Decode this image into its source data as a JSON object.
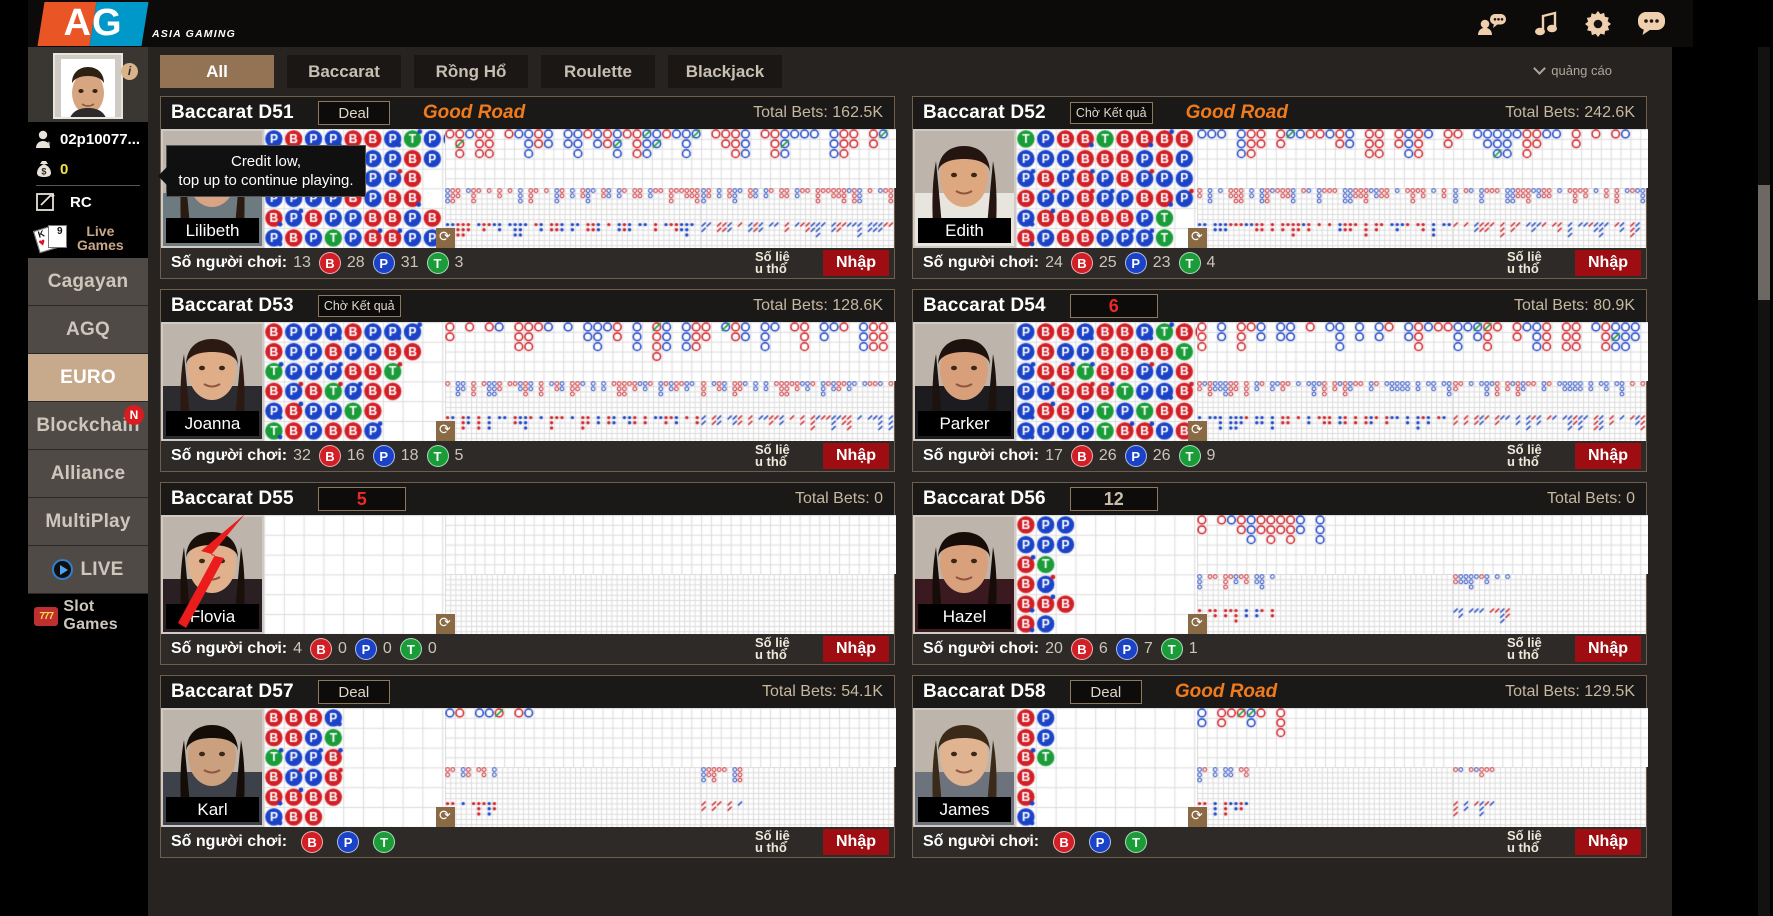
{
  "brand": {
    "logo_text": "AG",
    "tagline": "ASIA GAMING"
  },
  "topbar": {
    "icons": [
      {
        "name": "friends-chat-icon",
        "glyph": "friends"
      },
      {
        "name": "music-note-icon",
        "glyph": "music"
      },
      {
        "name": "gear-icon",
        "glyph": "gear"
      },
      {
        "name": "chat-bubble-icon",
        "glyph": "chat"
      }
    ]
  },
  "sidebar": {
    "account_name": "02p10077...",
    "balance": "0",
    "rc_label": "RC",
    "live_games_label": "Live\nGames",
    "live_games_line1": "Live",
    "live_games_line2": "Games",
    "info_badge": "i",
    "card_badge": "9",
    "items": [
      {
        "label": "Cagayan",
        "active": false,
        "badge": ""
      },
      {
        "label": "AGQ",
        "active": false,
        "badge": ""
      },
      {
        "label": "EURO",
        "active": true,
        "badge": ""
      },
      {
        "label": "Blockchain",
        "active": false,
        "badge": "N"
      },
      {
        "label": "Alliance",
        "active": false,
        "badge": ""
      },
      {
        "label": "MultiPlay",
        "active": false,
        "badge": ""
      },
      {
        "label": "LIVE",
        "active": false,
        "badge": ""
      },
      {
        "label": "Slot Games",
        "active": false,
        "badge": ""
      }
    ]
  },
  "tabs": [
    {
      "label": "All",
      "active": true
    },
    {
      "label": "Baccarat",
      "active": false
    },
    {
      "label": "Rồng Hổ",
      "active": false
    },
    {
      "label": "Roulette",
      "active": false
    },
    {
      "label": "Blackjack",
      "active": false
    }
  ],
  "advertisement_label": "quảng cáo",
  "tooltip": {
    "line1": "Credit low,",
    "line2": "top up to continue playing."
  },
  "footer_labels": {
    "players": "Số người chơi:",
    "stats_line1": "Số liệ",
    "stats_line2": "u thổ",
    "enter": "Nhập",
    "total_bets": "Total Bets:"
  },
  "colors": {
    "banker": "#d21f26",
    "player": "#1b43c8",
    "tie": "#1a9c38",
    "accent": "#937354",
    "good_road": "#f07b1d",
    "enter_button": "#9d0d12"
  },
  "tables": [
    {
      "name": "Baccarat D51",
      "state": "Deal",
      "state_type": "text",
      "good_road": "Good Road",
      "total_bets": "162.5K",
      "dealer": "Lilibeth",
      "dealer_hair": "#2a1a10",
      "dealer_skin": "#d8a484",
      "dealer_shirt": "#6d7a80",
      "players": "13",
      "b": "28",
      "p": "31",
      "t": "3",
      "bead": "PBPPBBPTPP|BBBPPPPBP|BBPPPPPB|PPPPBPBB|BPBPPBBPB|PBPTPBBPP",
      "empty": false
    },
    {
      "name": "Baccarat D52",
      "state": "Chờ Kết quả",
      "state_type": "wait",
      "good_road": "Good Road",
      "total_bets": "242.6K",
      "dealer": "Edith",
      "dealer_hair": "#241511",
      "dealer_skin": "#dda880",
      "dealer_shirt": "#e8e4de",
      "players": "24",
      "b": "25",
      "p": "23",
      "t": "4",
      "bead": "TPBBTBBBB|PPPBBBPBP|PBPBPBPPP|BPPBPPBBP|PBBBBBPT|BPBBPPPT",
      "empty": false
    },
    {
      "name": "Baccarat D53",
      "state": "Chờ Kết quả",
      "state_type": "wait",
      "good_road": "",
      "total_bets": "128.6K",
      "dealer": "Joanna",
      "dealer_hair": "#2c1a12",
      "dealer_skin": "#dfae88",
      "dealer_shirt": "#2b2b30",
      "players": "32",
      "b": "16",
      "p": "18",
      "t": "5",
      "bead": "BPPPBPPP|BPPBPPBB|TPPPBBT|BPBTPBB|PBPPTB|TBPBBP",
      "empty": false
    },
    {
      "name": "Baccarat D54",
      "state": "6",
      "state_type": "num-red",
      "good_road": "",
      "total_bets": "80.9K",
      "dealer": "Parker",
      "dealer_hair": "#1d120d",
      "dealer_skin": "#d8a07a",
      "dealer_shirt": "#1b1b20",
      "players": "17",
      "b": "26",
      "p": "26",
      "t": "9",
      "bead": "PBBPBBPTBB|PBPPBBBBT|PBBTBBPPB|PPBBBTPPB|PBBPTPTBB|PPPPTBBPB",
      "empty": false
    },
    {
      "name": "Baccarat D55",
      "state": "5",
      "state_type": "num-red",
      "good_road": "",
      "total_bets": "0",
      "dealer": "Flovia",
      "dealer_hair": "#1a1009",
      "dealer_skin": "#e0b18c",
      "dealer_shirt": "#2a1f22",
      "players": "4",
      "b": "0",
      "p": "0",
      "t": "0",
      "bead": "",
      "empty": true
    },
    {
      "name": "Baccarat D56",
      "state": "12",
      "state_type": "num-grey",
      "good_road": "",
      "total_bets": "0",
      "dealer": "Hazel",
      "dealer_hair": "#160d08",
      "dealer_skin": "#d9a07c",
      "dealer_shirt": "#3a1a20",
      "players": "20",
      "b": "6",
      "p": "7",
      "t": "1",
      "bead": "BPP|PPP|BT|BP|BBB|BP",
      "empty": false
    },
    {
      "name": "Baccarat D57",
      "state": "Deal",
      "state_type": "text",
      "good_road": "",
      "total_bets": "54.1K",
      "dealer": "Karl",
      "dealer_hair": "#140c07",
      "dealer_skin": "#caa07f",
      "dealer_shirt": "#3d4149",
      "players": "",
      "b": "",
      "p": "",
      "t": "",
      "bead": "BBBP|BBPT|TPPB|BPPB|BBBB|PBB",
      "empty": false
    },
    {
      "name": "Baccarat D58",
      "state": "Deal",
      "state_type": "text",
      "good_road": "Good Road",
      "total_bets": "129.5K",
      "dealer": "James",
      "dealer_hair": "#3b2a18",
      "dealer_skin": "#e0b491",
      "dealer_shirt": "#6d737c",
      "players": "",
      "b": "",
      "p": "",
      "t": "",
      "bead": "BP|BP|BT|B|B|P",
      "empty": false
    }
  ]
}
